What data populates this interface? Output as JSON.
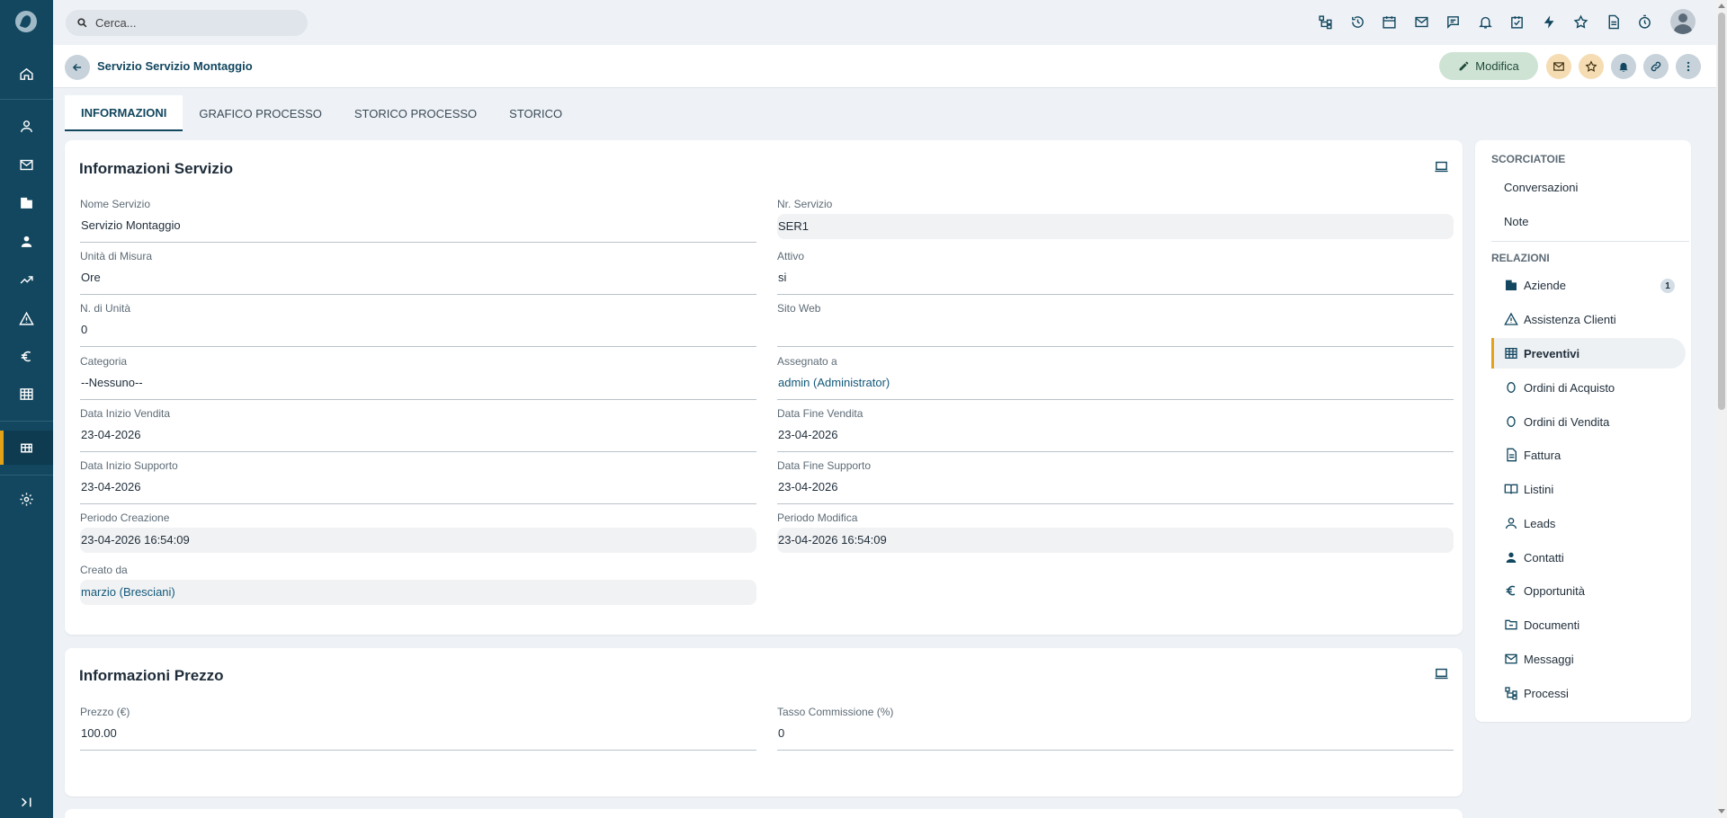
{
  "search": {
    "placeholder": "Cerca..."
  },
  "nav": {
    "items": [
      "logo-icon",
      "home-icon",
      "user-icon",
      "mail-icon",
      "building-icon",
      "contact-icon",
      "trend-icon",
      "warning-icon",
      "euro-icon",
      "table-icon",
      "grid-icon",
      "gear-icon",
      "expand-icon"
    ]
  },
  "topbar": {
    "icons": [
      "process-icon",
      "history-icon",
      "calendar-icon",
      "mail-icon",
      "chat-icon",
      "bell-icon",
      "task-icon",
      "bolt-icon",
      "star-icon",
      "document-icon",
      "timer-icon",
      "avatar"
    ]
  },
  "record": {
    "title": "Servizio Servizio Montaggio",
    "edit_label": "Modifica"
  },
  "tabs": [
    "INFORMAZIONI",
    "GRAFICO PROCESSO",
    "STORICO PROCESSO",
    "STORICO"
  ],
  "info_card": {
    "title": "Informazioni Servizio",
    "fields": [
      {
        "label": "Nome Servizio",
        "value": "Servizio Montaggio"
      },
      {
        "label": "Nr. Servizio",
        "value": "SER1"
      },
      {
        "label": "Unità di Misura",
        "value": "Ore"
      },
      {
        "label": "Attivo",
        "value": "si"
      },
      {
        "label": "N. di Unità",
        "value": "0"
      },
      {
        "label": "Sito Web",
        "value": ""
      },
      {
        "label": "Categoria",
        "value": "--Nessuno--"
      },
      {
        "label": "Assegnato a",
        "value": "admin (Administrator)"
      },
      {
        "label": "Data Inizio Vendita",
        "value": "23-04-2026"
      },
      {
        "label": "Data Fine Vendita",
        "value": "23-04-2026"
      },
      {
        "label": "Data Inizio Supporto",
        "value": "23-04-2026"
      },
      {
        "label": "Data Fine Supporto",
        "value": "23-04-2026"
      },
      {
        "label": "Periodo Creazione",
        "value": "23-04-2026 16:54:09"
      },
      {
        "label": "Periodo Modifica",
        "value": "23-04-2026 16:54:09"
      },
      {
        "label": "Creato da",
        "value": "marzio (Bresciani)"
      }
    ]
  },
  "price_card": {
    "title": "Informazioni Prezzo",
    "fields": [
      {
        "label": "Prezzo (€)",
        "value": "100.00"
      },
      {
        "label": "Tasso Commissione (%)",
        "value": "0"
      }
    ]
  },
  "sidebar": {
    "shortcuts_title": "SCORCIATOIE",
    "shortcuts": [
      "Conversazioni",
      "Note"
    ],
    "relations_title": "RELAZIONI",
    "relations": [
      {
        "label": "Aziende",
        "icon": "building-icon",
        "badge": "1"
      },
      {
        "label": "Assistenza Clienti",
        "icon": "warning-icon"
      },
      {
        "label": "Preventivi",
        "icon": "table-icon"
      },
      {
        "label": "Ordini di Acquisto",
        "icon": "circle-icon"
      },
      {
        "label": "Ordini di Vendita",
        "icon": "circle-icon"
      },
      {
        "label": "Fattura",
        "icon": "document-icon"
      },
      {
        "label": "Listini",
        "icon": "book-icon"
      },
      {
        "label": "Leads",
        "icon": "user-icon"
      },
      {
        "label": "Contatti",
        "icon": "contact-icon"
      },
      {
        "label": "Opportunità",
        "icon": "euro-icon"
      },
      {
        "label": "Documenti",
        "icon": "folder-icon"
      },
      {
        "label": "Messaggi",
        "icon": "mail-icon"
      },
      {
        "label": "Processi",
        "icon": "process-icon"
      }
    ]
  },
  "colors": {
    "nav_bg": "#12475f",
    "accent": "#e3a21a",
    "title_blue": "#12475f",
    "edit_button_bg": "#cfe3d5"
  }
}
